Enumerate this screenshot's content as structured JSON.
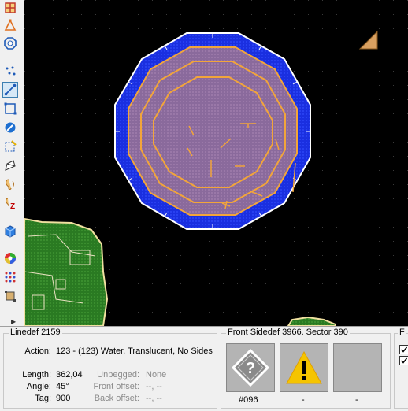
{
  "linedef": {
    "title": "Linedef 2159",
    "action_label": "Action:",
    "action_value": "123 - (123) Water, Translucent, No Sides",
    "length_label": "Length:",
    "length_value": "362,04",
    "angle_label": "Angle:",
    "angle_value": "45°",
    "tag_label": "Tag:",
    "tag_value": "900",
    "unpegged_label": "Unpegged:",
    "unpegged_value": "None",
    "front_offset_label": "Front offset:",
    "front_offset_value": "--, --",
    "back_offset_label": "Back offset:",
    "back_offset_value": "--, --"
  },
  "front_sidedef": {
    "title": "Front Sidedef 3966. Sector 390",
    "textures": [
      {
        "label": "#096",
        "icon": "missing-texture-icon"
      },
      {
        "label": "-",
        "icon": "warning-icon"
      },
      {
        "label": "-",
        "icon": ""
      }
    ]
  },
  "flags_group": {
    "title": "F"
  },
  "toolbar_icons": [
    "things-mode-icon",
    "vertices-mode-icon",
    "sectors-mode-icon",
    "vertex-dots-icon",
    "linedefs-mode-icon",
    "select-box-icon",
    "draw-icon",
    "select-region-icon",
    "edit-icon",
    "sound-icon",
    "z-height-icon",
    "cube-3d-icon",
    "color-wheel-icon",
    "grid-dots-icon",
    "transform-icon"
  ],
  "colors": {
    "map_bg": "#000000",
    "water_blue": "#1a2fe0",
    "sector_purple": "#8a6aa0",
    "highlight_orange": "#f2a53a",
    "grass_green": "#2a7a22"
  }
}
